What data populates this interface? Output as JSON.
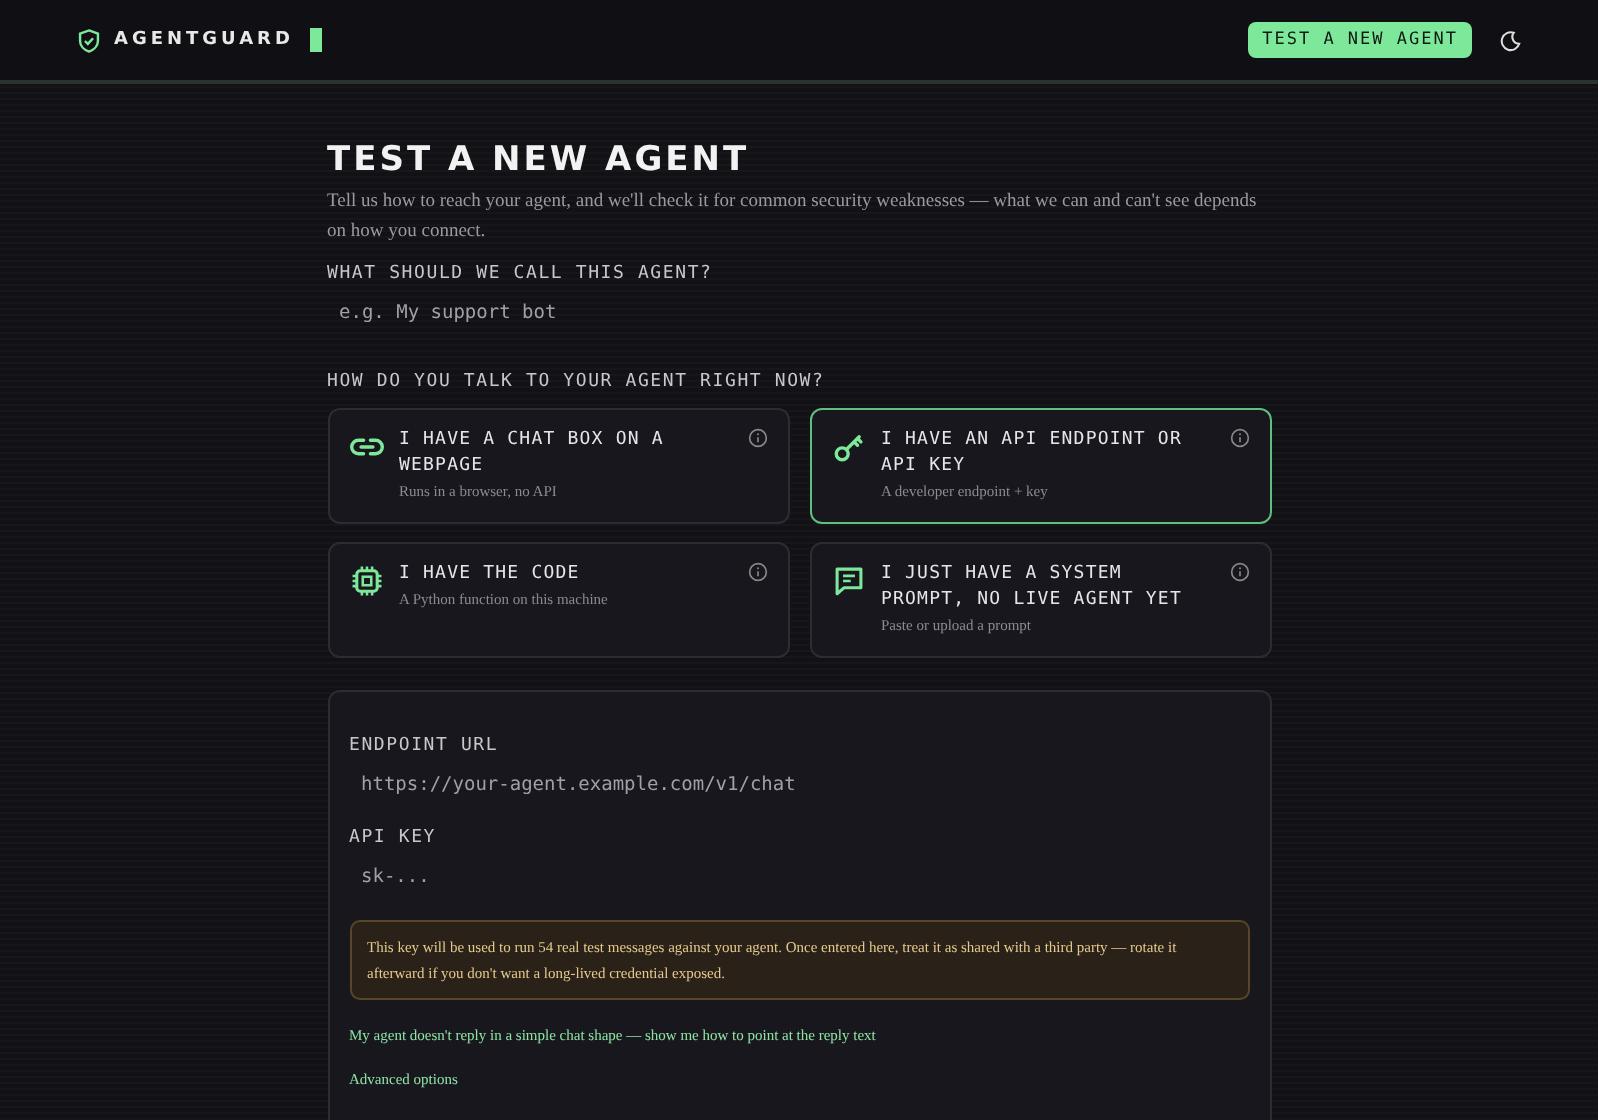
{
  "header": {
    "brand": "AGENTGUARD",
    "cta": "TEST A NEW AGENT"
  },
  "title": "TEST A NEW AGENT",
  "description": "Tell us how to reach your agent, and we'll check it for common security weaknesses — what we can and can't see depends on how you connect.",
  "name_field": {
    "label": "WHAT SHOULD WE CALL THIS AGENT?",
    "placeholder": "e.g. My support bot"
  },
  "connection": {
    "label": "HOW DO YOU TALK TO YOUR AGENT RIGHT NOW?",
    "options": [
      {
        "kind": "link",
        "title": "I HAVE A CHAT BOX ON A WEBPAGE",
        "subtitle": "Runs in a browser, no API",
        "selected": false
      },
      {
        "kind": "key",
        "title": "I HAVE AN API ENDPOINT OR API KEY",
        "subtitle": "A developer endpoint + key",
        "selected": true
      },
      {
        "kind": "chip",
        "title": "I HAVE THE CODE",
        "subtitle": "A Python function on this machine",
        "selected": false
      },
      {
        "kind": "chat",
        "title": "I JUST HAVE A SYSTEM PROMPT, NO LIVE AGENT YET",
        "subtitle": "Paste or upload a prompt",
        "selected": false
      }
    ]
  },
  "details": {
    "fields": [
      {
        "label": "ENDPOINT URL",
        "placeholder": "https://your-agent.example.com/v1/chat"
      },
      {
        "label": "API KEY",
        "placeholder": "sk-..."
      }
    ],
    "warning": "This key will be used to run 54 real test messages against your agent. Once entered here, treat it as shared with a third party — rotate it afterward if you don't want a long-lived credential exposed.",
    "links": [
      "My agent doesn't reply in a simple chat shape — show me how to point at the reply text",
      "Advanced options"
    ]
  }
}
